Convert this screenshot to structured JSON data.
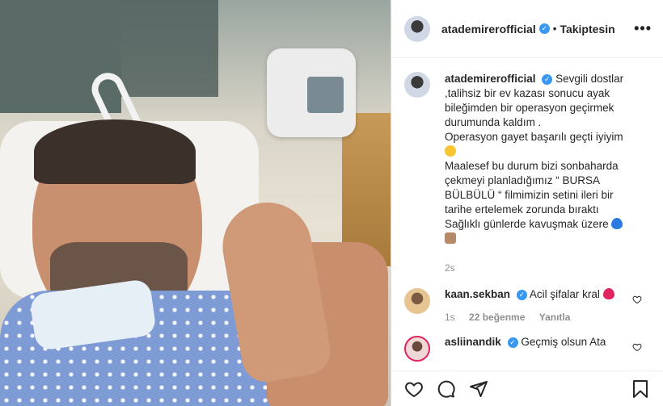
{
  "post": {
    "author": "atademirerofficial",
    "verified_symbol": "✓",
    "separator": "•",
    "follow_status": "Takiptesin",
    "more_label": "•••",
    "caption_lines": [
      "Sevgili dostlar",
      ",talihsiz bir ev kazası sonucu ayak bileğimden bir operasyon geçirmek durumunda kaldım .",
      "Operasyon gayet başarılı geçti iyiyim",
      "Maalesef bu durum bizi sonbaharda çekmeyi planladığımız “ BURSA BÜLBÜLÜ “ filmimizin setini ileri bir tarihe ertelemek zorunda bıraktı",
      "Sağlıklı günlerde kavuşmak üzere"
    ],
    "time_ago": "2s"
  },
  "comments": [
    {
      "author": "kaan.sekban",
      "text": "Acil şifalar kral",
      "time": "1s",
      "likes": "22 beğenme",
      "reply": "Yanıtla"
    },
    {
      "author": "asliinandik",
      "text": "Geçmiş olsun Ata"
    }
  ],
  "colors": {
    "verified": "#3897f0",
    "muted": "#8e8e8e",
    "text": "#262626"
  },
  "icons": [
    "heart-icon",
    "comment-icon",
    "share-icon",
    "bookmark-icon",
    "more-icon",
    "verified-icon"
  ]
}
